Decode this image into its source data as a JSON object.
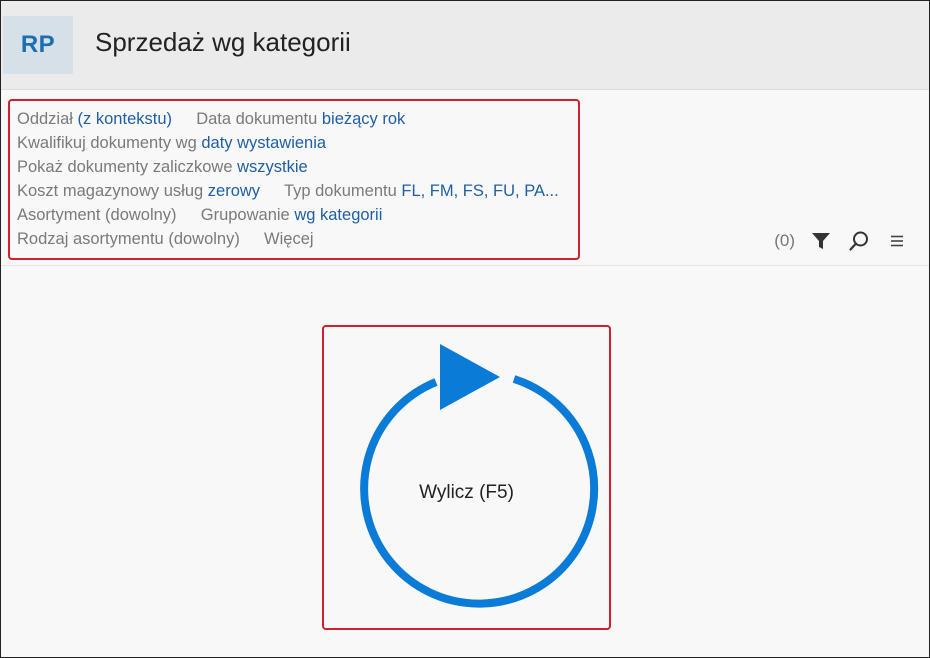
{
  "app": {
    "badge": "RP",
    "title": "Sprzedaż wg kategorii"
  },
  "params": {
    "row1": [
      {
        "label": "Oddział",
        "value": "(z kontekstu)"
      },
      {
        "label": "Data dokumentu",
        "value": "bieżący rok"
      }
    ],
    "row2": [
      {
        "label": "Kwalifikuj dokumenty wg",
        "value": "daty wystawienia"
      }
    ],
    "row3": [
      {
        "label": "Pokaż dokumenty zaliczkowe",
        "value": "wszystkie"
      }
    ],
    "row4": [
      {
        "label": "Koszt magazynowy usług",
        "value": "zerowy"
      },
      {
        "label": "Typ dokumentu",
        "value": "FL, FM, FS, FU, PA..."
      }
    ],
    "row5": [
      {
        "label": "Asortyment (dowolny)"
      },
      {
        "label": "Grupowanie",
        "value": "wg kategorii"
      }
    ],
    "row6": [
      {
        "label": "Rodzaj asortymentu (dowolny)"
      },
      {
        "label": "Więcej"
      }
    ]
  },
  "toolbar": {
    "count": "(0)",
    "icons": [
      "filter-icon",
      "search-icon",
      "menu-icon"
    ]
  },
  "calculate": {
    "label": "Wylicz (F5)",
    "color": "#0a7bd6"
  }
}
